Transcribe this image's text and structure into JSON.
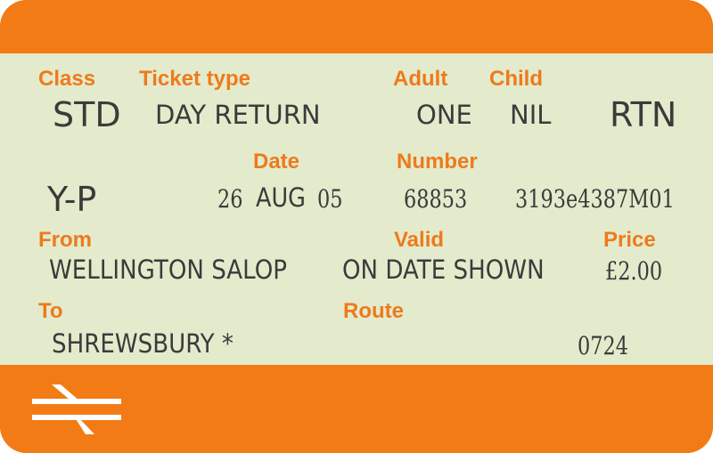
{
  "labels": {
    "class": "Class",
    "ticket_type": "Ticket type",
    "adult": "Adult",
    "child": "Child",
    "date": "Date",
    "number": "Number",
    "from": "From",
    "valid": "Valid",
    "price": "Price",
    "to": "To",
    "route": "Route"
  },
  "values": {
    "class": "STD",
    "ticket_type": "DAY RETURN",
    "adult": "ONE",
    "child": "NIL",
    "journey": "RTN",
    "code": "Y-P",
    "date_day": "26",
    "date_month": "AUG",
    "date_year": "05",
    "number": "68853",
    "serial": "3193e4387M01",
    "from": "WELLINGTON SALOP",
    "valid": "ON DATE SHOWN",
    "price": "£2.00",
    "to": "SHREWSBURY *",
    "route_code": "0724"
  },
  "colors": {
    "band": "#f37b15",
    "body": "#e3ebcc",
    "label": "#ee7a1c",
    "text": "#3b3b3b",
    "logo": "#ffffff"
  },
  "icons": {
    "logo": "double-arrow-icon"
  }
}
